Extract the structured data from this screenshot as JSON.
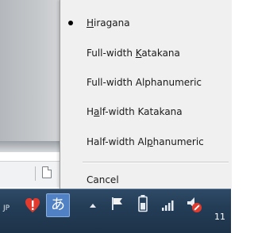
{
  "ime_menu": {
    "items": [
      {
        "pre": "",
        "hotkey": "H",
        "post": "iragana",
        "checked": true
      },
      {
        "pre": "Full-width ",
        "hotkey": "K",
        "post": "atakana",
        "checked": false
      },
      {
        "pre": "Full-width Alphanumeric",
        "hotkey": "",
        "post": "",
        "checked": false
      },
      {
        "pre": "H",
        "hotkey": "a",
        "post": "lf-width Katakana",
        "checked": false
      },
      {
        "pre": "Half-width Al",
        "hotkey": "p",
        "post": "hanumeric",
        "checked": false
      }
    ],
    "cancel": "Cancel"
  },
  "taskbar": {
    "language": "JP",
    "ime_mode_glyph": "あ",
    "clock_partial": "11"
  },
  "icons": {
    "bullet": "bullet-dot",
    "flag": "action-center-flag-icon",
    "battery": "battery-icon",
    "network": "network-signal-icon",
    "volume": "speaker-muted-icon",
    "show_hidden": "show-hidden-icons-arrow",
    "alert": "red-alert-icon"
  },
  "colors": {
    "menu_bg": "#f0f0f0",
    "taskbar_bg": "#243d57",
    "ime_icon_bg": "#4f81c4",
    "alert_red": "#e23b2e"
  }
}
